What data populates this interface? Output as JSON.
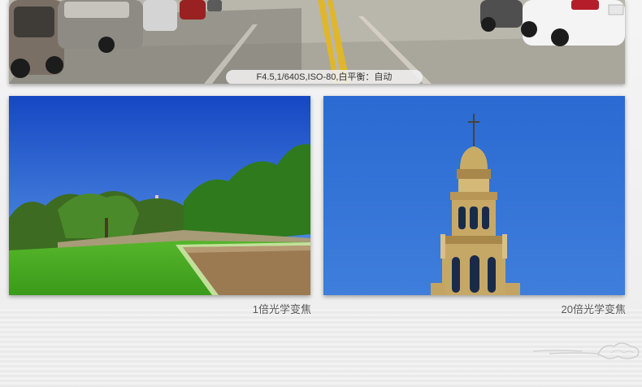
{
  "top_photo": {
    "exif": "F4.5,1/640S,ISO-80,白平衡：自动"
  },
  "captions": {
    "left": "1倍光学变焦",
    "right": "20倍光学变焦"
  }
}
